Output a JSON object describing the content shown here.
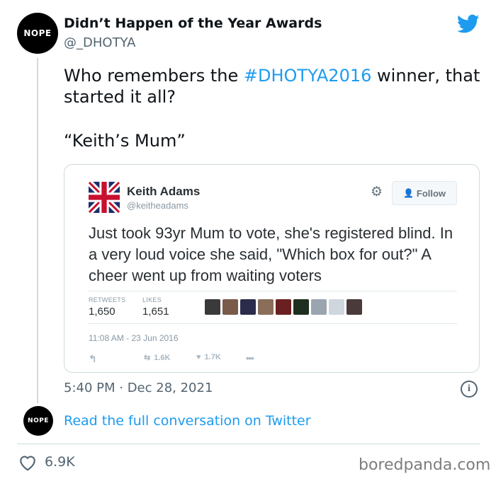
{
  "author": {
    "avatar_text": "NOPE",
    "name": "Didn’t Happen of the Year Awards",
    "handle": "@_DHOTYA"
  },
  "tweet": {
    "text_before": "Who remembers the ",
    "hashtag": "#DHOTYA2016",
    "text_after": " winner, that started it all?",
    "quote": "“Keith’s Mum”",
    "date": "5:40 PM · Dec 28, 2021"
  },
  "embedded_tweet": {
    "name": "Keith Adams",
    "handle": "@keitheadams",
    "follow_label": "Follow",
    "text": "Just took 93yr Mum to vote, she's registered blind. In a very loud voice she said, \"Which box for out?\" A cheer went up from waiting voters",
    "retweets_label": "RETWEETS",
    "retweets_value": "1,650",
    "likes_label": "LIKES",
    "likes_value": "1,651",
    "timestamp": "11:08 AM - 23 Jun 2016",
    "action_retweets": "1.6K",
    "action_likes": "1.7K",
    "action_more": "•••",
    "liker_colors": [
      "#3a3a3a",
      "#7a5a4a",
      "#2b2b4b",
      "#8a6e5a",
      "#6a2020",
      "#1f2f1f",
      "#9aa5b0",
      "#cfd6de",
      "#4a3a3a"
    ]
  },
  "footer": {
    "small_avatar_text": "NOPE",
    "read_link": "Read the full conversation on Twitter",
    "like_count": "6.9K",
    "watermark": "boredpanda.com"
  },
  "colors": {
    "link": "#1d9bf0",
    "twitter_blue": "#1d9bf0",
    "muted": "#536471"
  }
}
